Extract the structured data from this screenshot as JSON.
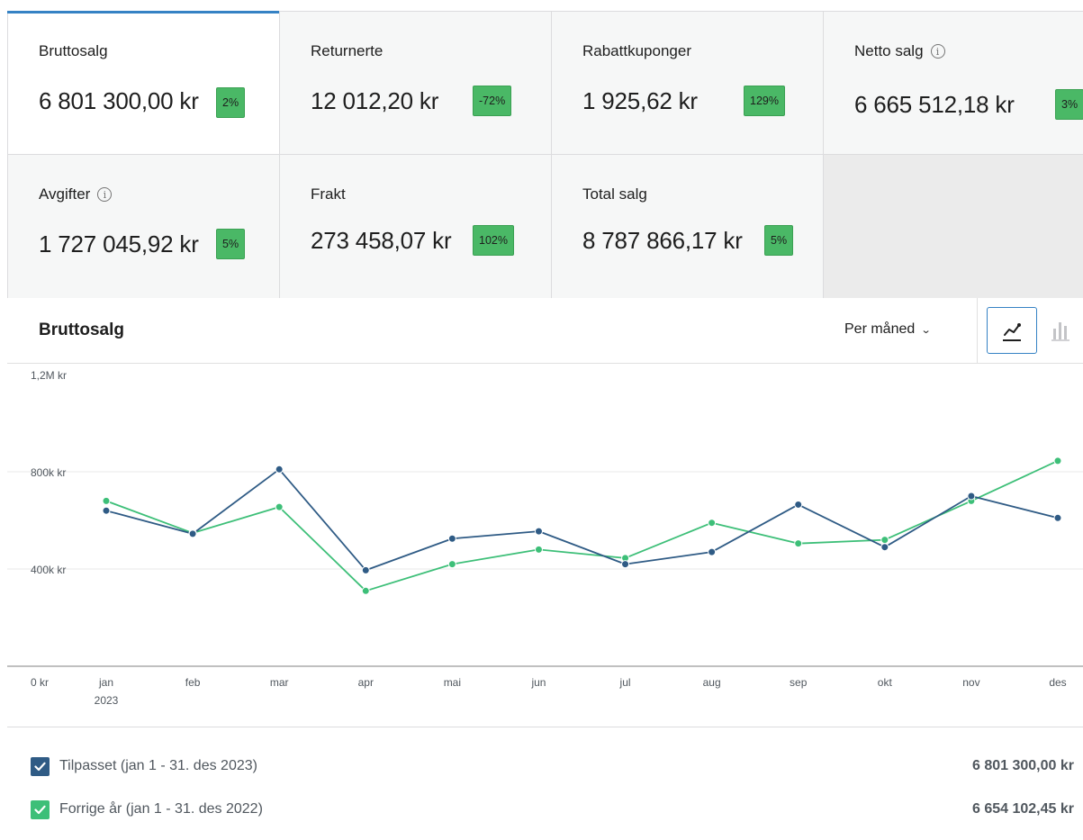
{
  "colors": {
    "accent": "#3582c4",
    "delta_positive": "#4ab866",
    "series_current": "#2f5b85",
    "series_previous": "#3dbf78"
  },
  "kpis": [
    {
      "label": "Bruttosalg",
      "value": "6 801 300,00 kr",
      "delta": "2%",
      "active": true,
      "info": false
    },
    {
      "label": "Returnerte",
      "value": "12 012,20 kr",
      "delta": "-72%",
      "info": false
    },
    {
      "label": "Rabattkuponger",
      "value": "1 925,62 kr",
      "delta": "129%",
      "info": false
    },
    {
      "label": "Netto salg",
      "value": "6 665 512,18 kr",
      "delta": "3%",
      "info": true
    },
    {
      "label": "Avgifter",
      "value": "1 727 045,92 kr",
      "delta": "5%",
      "info": true
    },
    {
      "label": "Frakt",
      "value": "273 458,07 kr",
      "delta": "102%",
      "info": false
    },
    {
      "label": "Total salg",
      "value": "8 787 866,17 kr",
      "delta": "5%",
      "info": false
    }
  ],
  "chart_header": {
    "title": "Bruttosalg",
    "interval": "Per måned",
    "chart_type": "line"
  },
  "chart_data": {
    "type": "line",
    "categories": [
      "jan",
      "feb",
      "mar",
      "apr",
      "mai",
      "jun",
      "jul",
      "aug",
      "sep",
      "okt",
      "nov",
      "des"
    ],
    "first_category_sublabel": "2023",
    "y_ticks": [
      "0 kr",
      "400k kr",
      "800k kr",
      "1,2M kr"
    ],
    "y_tick_values": [
      0,
      400000,
      800000,
      1200000
    ],
    "ylim": [
      0,
      1200000
    ],
    "grid": true,
    "series": [
      {
        "name": "Tilpasset (jan 1 - 31. des 2023)",
        "color": "#2f5b85",
        "values": [
          640000,
          545000,
          810000,
          395000,
          525000,
          555000,
          420000,
          470000,
          665000,
          490000,
          700000,
          610000
        ]
      },
      {
        "name": "Forrige år (jan 1 - 31. des 2022)",
        "color": "#3dbf78",
        "values": [
          680000,
          548000,
          655000,
          310000,
          420000,
          480000,
          445000,
          590000,
          505000,
          520000,
          680000,
          845000
        ]
      }
    ]
  },
  "legend": [
    {
      "label": "Tilpasset (jan 1 - 31. des 2023)",
      "total": "6 801 300,00 kr",
      "checked": true,
      "color": "#2f5b85"
    },
    {
      "label": "Forrige år (jan 1 - 31. des 2022)",
      "total": "6 654 102,45 kr",
      "checked": true,
      "color": "#3dbf78"
    }
  ]
}
